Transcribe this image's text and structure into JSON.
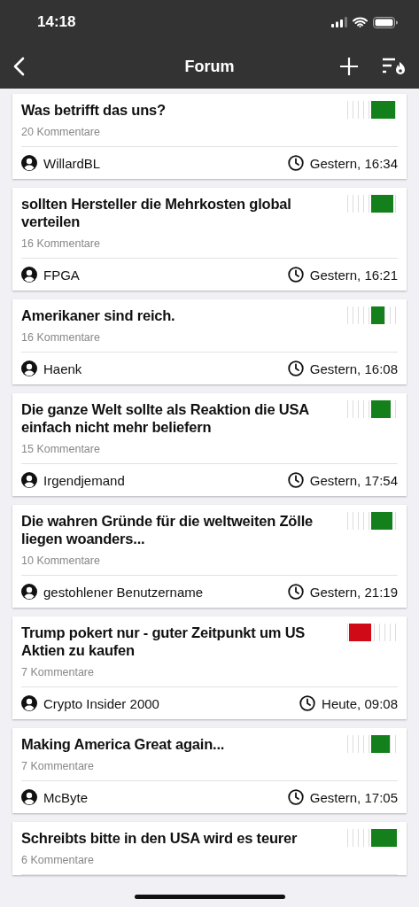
{
  "status_bar": {
    "time": "14:18"
  },
  "nav": {
    "title": "Forum"
  },
  "topics": [
    {
      "title": "Was betrifft das uns?",
      "comments": "20 Kommentare",
      "author": "WillardBL",
      "time": "Gestern, 16:34",
      "vote": {
        "kind": "positive",
        "level": 0.9
      }
    },
    {
      "title": "sollten Hersteller die Mehrkosten global verteilen",
      "comments": "16 Kommentare",
      "author": "FPGA",
      "time": "Gestern, 16:21",
      "vote": {
        "kind": "positive",
        "level": 0.83
      }
    },
    {
      "title": "Amerikaner sind reich.",
      "comments": "16 Kommentare",
      "author": "Haenk",
      "time": "Gestern, 16:08",
      "vote": {
        "kind": "positive"
      }
    },
    {
      "title": "Die ganze Welt sollte als Reaktion die USA einfach nicht mehr beliefern",
      "comments": "15 Kommentare",
      "author": "Irgendjemand",
      "time": "Gestern, 17:54",
      "vote": {
        "kind": "positive",
        "level": 0.73
      }
    },
    {
      "title": "Die wahren Gründe für die weltweiten Zölle liegen woanders...",
      "comments": "10 Kommentare",
      "author": "gestohlener Benutzername",
      "time": "Gestern, 21:19",
      "vote": {
        "kind": "positive",
        "level": 0.8
      }
    },
    {
      "title": "Trump pokert nur - guter Zeitpunkt um US Aktien zu kaufen",
      "comments": "7 Kommentare",
      "author": "Crypto Insider 2000",
      "time": "Heute, 09:08",
      "vote": {
        "kind": "negative"
      }
    },
    {
      "title": "Making America Great again...",
      "comments": "7 Kommentare",
      "author": "McByte",
      "time": "Gestern, 17:05",
      "vote": {
        "kind": "positive",
        "level": 0.7
      }
    },
    {
      "title": "Schreibts bitte in den USA wird es teurer",
      "comments": "6 Kommentare",
      "vote": {
        "kind": "positive",
        "level": 0.97
      }
    }
  ]
}
